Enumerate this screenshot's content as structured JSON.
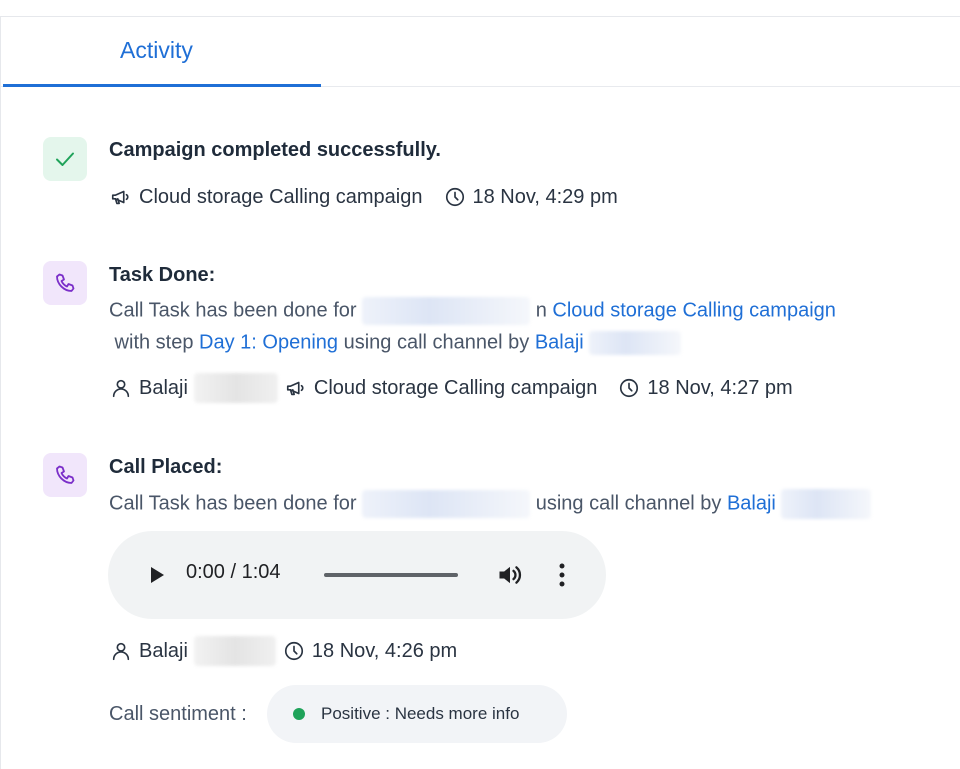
{
  "tabs": [
    {
      "label": "Activity",
      "active": true
    }
  ],
  "colors": {
    "accent": "#1f6fd6",
    "success": "#1fa35a",
    "call_badge_bg": "#f1e6fb",
    "success_badge_bg": "#e4f6ec"
  },
  "activities": [
    {
      "icon": "check-icon",
      "title": "Campaign completed successfully.",
      "campaign": "Cloud storage Calling campaign",
      "timestamp": "18 Nov, 4:29 pm"
    },
    {
      "icon": "phone-icon",
      "title": "Task Done:",
      "text_1": "Call Task has been done  for",
      "text_2": "n",
      "campaign_link": "Cloud storage Calling campaign",
      "text_3": " with step ",
      "step_link": "Day 1: Opening",
      "text_4": " using call channel by ",
      "user_link": "Balaji",
      "user": "Balaji",
      "campaign": "Cloud storage Calling campaign",
      "timestamp": "18 Nov, 4:27 pm"
    },
    {
      "icon": "phone-icon",
      "title": "Call Placed:",
      "text_1": "Call Task has been done  for",
      "text_2": "using call channel by ",
      "user_link": "Balaji",
      "audio": {
        "time": "0:00 / 1:04",
        "progress": 0
      },
      "user": "Balaji",
      "timestamp": "18 Nov, 4:26 pm",
      "sentiment_label": "Call sentiment :",
      "sentiment": "Positive : Needs more info"
    }
  ]
}
